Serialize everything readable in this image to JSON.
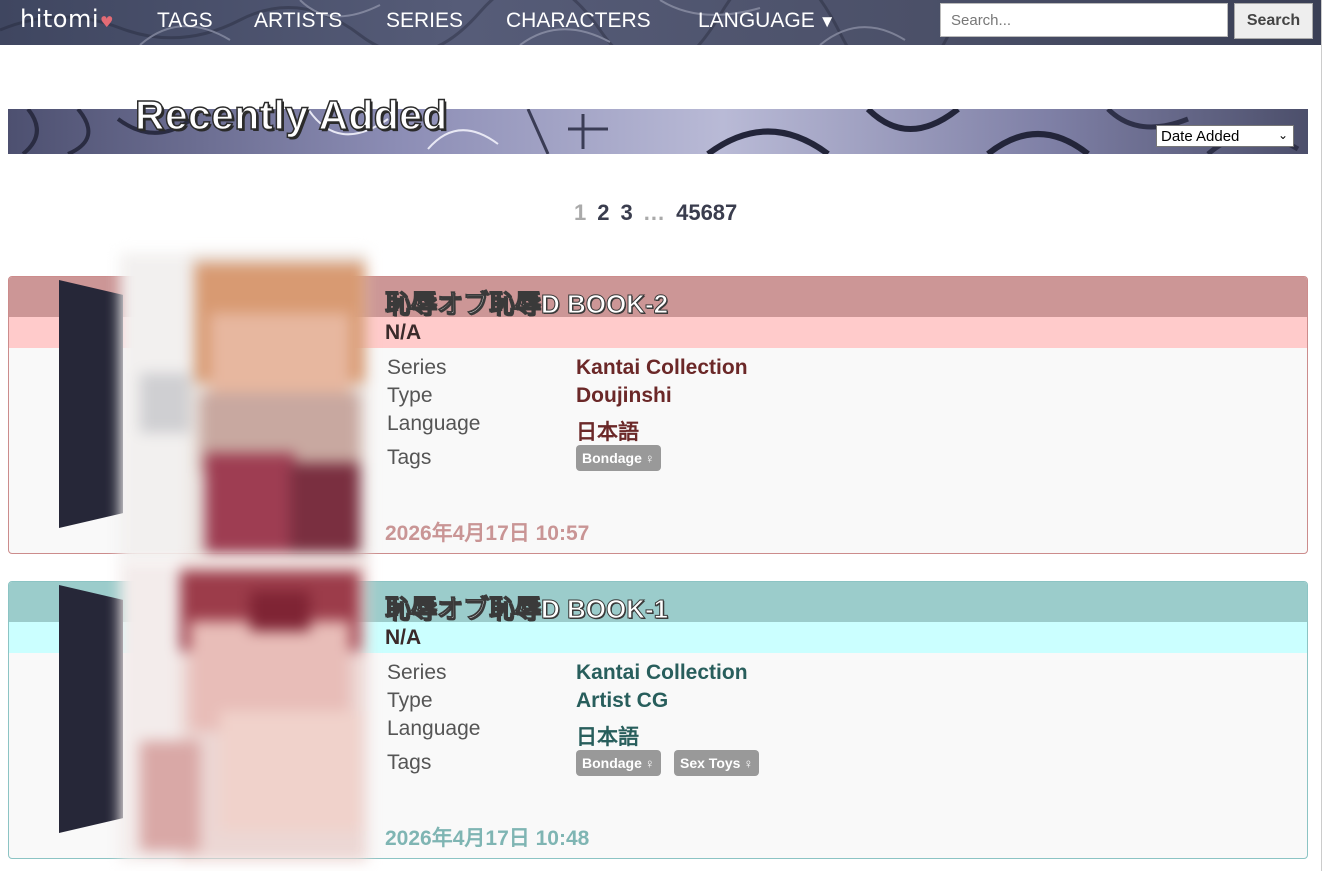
{
  "nav": {
    "logo": "hitomi",
    "logo_heart": "♥",
    "links": [
      "TAGS",
      "ARTISTS",
      "SERIES",
      "CHARACTERS",
      "LANGUAGE"
    ],
    "language_caret": "▼",
    "search_placeholder": "Search...",
    "search_button": "Search"
  },
  "header": {
    "title": "Recently Added",
    "sort_selected": "Date Added"
  },
  "pagination": {
    "current": "1",
    "pages": [
      "2",
      "3"
    ],
    "ellipsis": "...",
    "last": "45687"
  },
  "galleries": [
    {
      "title": "恥辱オブ恥辱D BOOK-2",
      "artist": "N/A",
      "labels": {
        "series": "Series",
        "type": "Type",
        "language": "Language",
        "tags": "Tags"
      },
      "series": "Kantai Collection",
      "type": "Doujinshi",
      "language": "日本語",
      "tags": [
        "Bondage"
      ],
      "date": "2026年4月17日 10:57",
      "colors": {
        "title_bar": "#cc9696",
        "artist_bar": "#ffcbcb",
        "border": "#cc8c8c",
        "value": "#6b2828",
        "date": "#c99595"
      }
    },
    {
      "title": "恥辱オブ恥辱D BOOK-1",
      "artist": "N/A",
      "labels": {
        "series": "Series",
        "type": "Type",
        "language": "Language",
        "tags": "Tags"
      },
      "series": "Kantai Collection",
      "type": "Artist CG",
      "language": "日本語",
      "tags": [
        "Bondage",
        "Sex Toys"
      ],
      "date": "2026年4月17日 10:48",
      "colors": {
        "title_bar": "#9bcccb",
        "artist_bar": "#cbffff",
        "border": "#8cc4c4",
        "value": "#285e5c",
        "date": "#7fb5b3"
      }
    }
  ],
  "icons": {
    "female_tag": "female-icon"
  }
}
